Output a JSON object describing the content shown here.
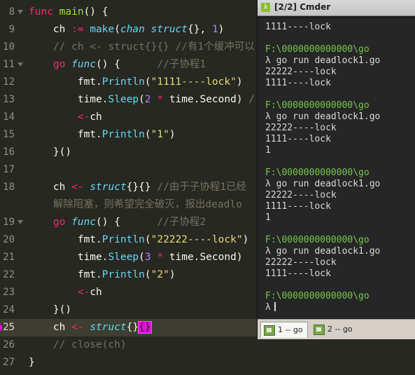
{
  "editor": {
    "lines": [
      {
        "no": "8",
        "fold": true,
        "current": false,
        "tokens": [
          [
            "kf",
            "func"
          ],
          [
            "t",
            " "
          ],
          [
            "g",
            "main"
          ],
          [
            "t",
            "() {"
          ]
        ]
      },
      {
        "no": "9",
        "fold": false,
        "current": false,
        "tokens": [
          [
            "t",
            "    ch "
          ],
          [
            "k",
            ":="
          ],
          [
            "t",
            " "
          ],
          [
            "f",
            "make"
          ],
          [
            "t",
            "("
          ],
          [
            "fi",
            "chan"
          ],
          [
            "t",
            " "
          ],
          [
            "fi",
            "struct"
          ],
          [
            "t",
            "{}, "
          ],
          [
            "n",
            "1"
          ],
          [
            "t",
            ")"
          ]
        ]
      },
      {
        "no": "10",
        "fold": false,
        "current": false,
        "tokens": [
          [
            "c",
            "    // ch <- struct{}{} //有1个缓冲可以"
          ]
        ]
      },
      {
        "no": "11",
        "fold": true,
        "current": false,
        "tokens": [
          [
            "t",
            "    "
          ],
          [
            "k",
            "go"
          ],
          [
            "t",
            " "
          ],
          [
            "fi",
            "func"
          ],
          [
            "t",
            "() {      "
          ],
          [
            "c",
            "//子协程1"
          ]
        ]
      },
      {
        "no": "12",
        "fold": false,
        "current": false,
        "tokens": [
          [
            "t",
            "        fmt."
          ],
          [
            "f",
            "Println"
          ],
          [
            "t",
            "("
          ],
          [
            "s",
            "\"1111----lock\""
          ],
          [
            "t",
            ")"
          ]
        ]
      },
      {
        "no": "13",
        "fold": false,
        "current": false,
        "tokens": [
          [
            "t",
            "        time."
          ],
          [
            "f",
            "Sleep"
          ],
          [
            "t",
            "("
          ],
          [
            "n",
            "2"
          ],
          [
            "t",
            " "
          ],
          [
            "k",
            "*"
          ],
          [
            "t",
            " time.Second) "
          ],
          [
            "c",
            "/"
          ]
        ]
      },
      {
        "no": "14",
        "fold": false,
        "current": false,
        "tokens": [
          [
            "t",
            "        "
          ],
          [
            "k",
            "<-"
          ],
          [
            "t",
            "ch"
          ]
        ]
      },
      {
        "no": "15",
        "fold": false,
        "current": false,
        "tokens": [
          [
            "t",
            "        fmt."
          ],
          [
            "f",
            "Println"
          ],
          [
            "t",
            "("
          ],
          [
            "s",
            "\"1\""
          ],
          [
            "t",
            ")"
          ]
        ]
      },
      {
        "no": "16",
        "fold": false,
        "current": false,
        "tokens": [
          [
            "t",
            "    }()"
          ]
        ]
      },
      {
        "no": "17",
        "fold": false,
        "current": false,
        "tokens": []
      },
      {
        "no": "18",
        "fold": false,
        "current": false,
        "tokens": [
          [
            "t",
            "    ch "
          ],
          [
            "k",
            "<-"
          ],
          [
            "t",
            " "
          ],
          [
            "fi",
            "struct"
          ],
          [
            "t",
            "{}{} "
          ],
          [
            "c",
            "//由于子协程1已经"
          ]
        ]
      },
      {
        "no": "",
        "fold": false,
        "current": false,
        "tokens": [
          [
            "c",
            "    解除阻塞，则希望完全破灭，报出deadlo"
          ]
        ]
      },
      {
        "no": "19",
        "fold": true,
        "current": false,
        "tokens": [
          [
            "t",
            "    "
          ],
          [
            "k",
            "go"
          ],
          [
            "t",
            " "
          ],
          [
            "fi",
            "func"
          ],
          [
            "t",
            "() {      "
          ],
          [
            "c",
            "//子协程2"
          ]
        ]
      },
      {
        "no": "20",
        "fold": false,
        "current": false,
        "tokens": [
          [
            "t",
            "        fmt."
          ],
          [
            "f",
            "Println"
          ],
          [
            "t",
            "("
          ],
          [
            "s",
            "\"22222----lock\""
          ],
          [
            "t",
            ")"
          ]
        ]
      },
      {
        "no": "21",
        "fold": false,
        "current": false,
        "tokens": [
          [
            "t",
            "        time."
          ],
          [
            "f",
            "Sleep"
          ],
          [
            "t",
            "("
          ],
          [
            "n",
            "3"
          ],
          [
            "t",
            " "
          ],
          [
            "k",
            "*"
          ],
          [
            "t",
            " time.Second)"
          ]
        ]
      },
      {
        "no": "22",
        "fold": false,
        "current": false,
        "tokens": [
          [
            "t",
            "        fmt."
          ],
          [
            "f",
            "Println"
          ],
          [
            "t",
            "("
          ],
          [
            "s",
            "\"2\""
          ],
          [
            "t",
            ")"
          ]
        ]
      },
      {
        "no": "23",
        "fold": false,
        "current": false,
        "tokens": [
          [
            "t",
            "        "
          ],
          [
            "k",
            "<-"
          ],
          [
            "t",
            "ch"
          ]
        ]
      },
      {
        "no": "24",
        "fold": false,
        "current": false,
        "tokens": [
          [
            "t",
            "    }()"
          ]
        ]
      },
      {
        "no": "25",
        "fold": false,
        "current": true,
        "tokens": [
          [
            "t",
            "    ch "
          ],
          [
            "k",
            "<-"
          ],
          [
            "t",
            " "
          ],
          [
            "fi",
            "struct"
          ],
          [
            "t",
            "{}"
          ],
          [
            "hl",
            "{}"
          ]
        ]
      },
      {
        "no": "26",
        "fold": false,
        "current": false,
        "tokens": [
          [
            "c",
            "    // close(ch)"
          ]
        ]
      },
      {
        "no": "27",
        "fold": false,
        "current": false,
        "tokens": [
          [
            "t",
            "}"
          ]
        ]
      }
    ]
  },
  "cmder": {
    "title_icon": "λ",
    "title": "[2/2] Cmder",
    "output": [
      {
        "text": "1111----lock",
        "kind": "out"
      },
      {
        "text": "",
        "kind": "out"
      },
      {
        "text": "F:\\0000000000000\\go",
        "kind": "path"
      },
      {
        "text": "λ go run deadlock1.go",
        "kind": "out"
      },
      {
        "text": "22222----lock",
        "kind": "out"
      },
      {
        "text": "1111----lock",
        "kind": "out"
      },
      {
        "text": "",
        "kind": "out"
      },
      {
        "text": "F:\\0000000000000\\go",
        "kind": "path"
      },
      {
        "text": "λ go run deadlock1.go",
        "kind": "out"
      },
      {
        "text": "22222----lock",
        "kind": "out"
      },
      {
        "text": "1111----lock",
        "kind": "out"
      },
      {
        "text": "1",
        "kind": "out"
      },
      {
        "text": "",
        "kind": "out"
      },
      {
        "text": "F:\\0000000000000\\go",
        "kind": "path"
      },
      {
        "text": "λ go run deadlock1.go",
        "kind": "out"
      },
      {
        "text": "22222----lock",
        "kind": "out"
      },
      {
        "text": "1111----lock",
        "kind": "out"
      },
      {
        "text": "1",
        "kind": "out"
      },
      {
        "text": "",
        "kind": "out"
      },
      {
        "text": "F:\\0000000000000\\go",
        "kind": "path"
      },
      {
        "text": "λ go run deadlock1.go",
        "kind": "out"
      },
      {
        "text": "22222----lock",
        "kind": "out"
      },
      {
        "text": "1111----lock",
        "kind": "out"
      },
      {
        "text": "",
        "kind": "out"
      },
      {
        "text": "F:\\0000000000000\\go",
        "kind": "path"
      },
      {
        "text": "λ",
        "kind": "prompt"
      }
    ],
    "tabs": [
      {
        "label": "1 -- go",
        "active": true
      },
      {
        "label": "2 -- go",
        "active": false
      }
    ]
  }
}
